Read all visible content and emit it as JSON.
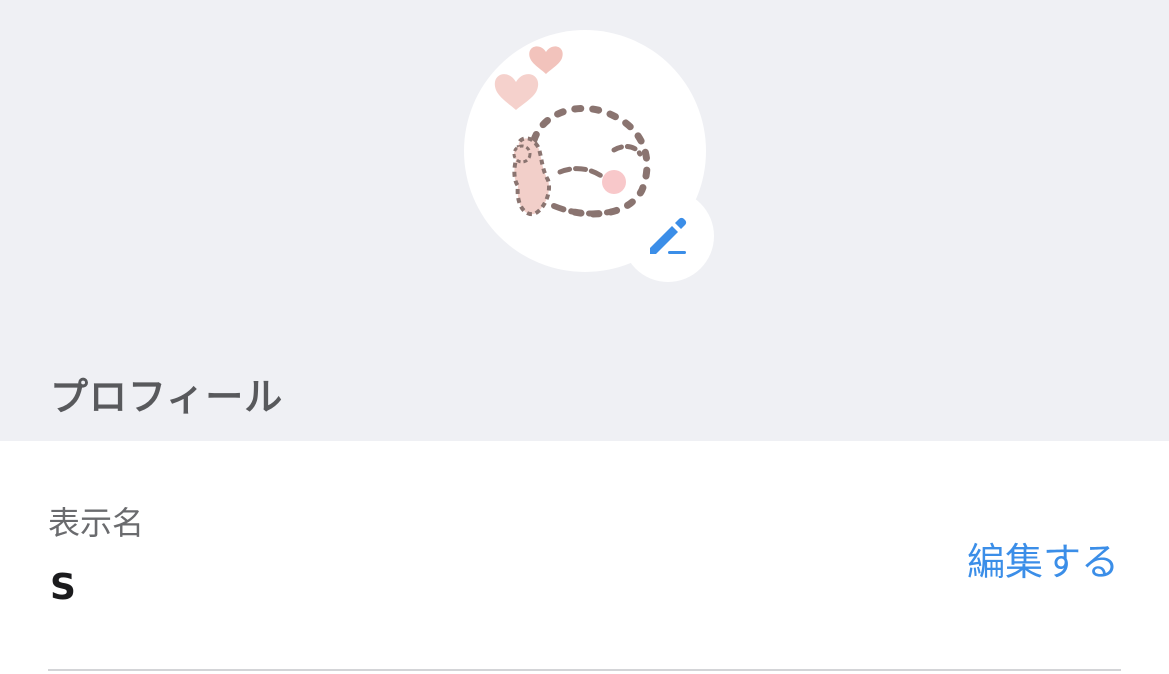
{
  "profile": {
    "section_title": "プロフィール",
    "avatar_icon": "avatar-image",
    "edit_icon": "pencil-icon"
  },
  "display_name": {
    "label": "表示名",
    "value": "S",
    "edit_label": "編集する"
  },
  "colors": {
    "background": "#eff0f4",
    "accent": "#3b8ee8",
    "title_text": "#58595c"
  }
}
